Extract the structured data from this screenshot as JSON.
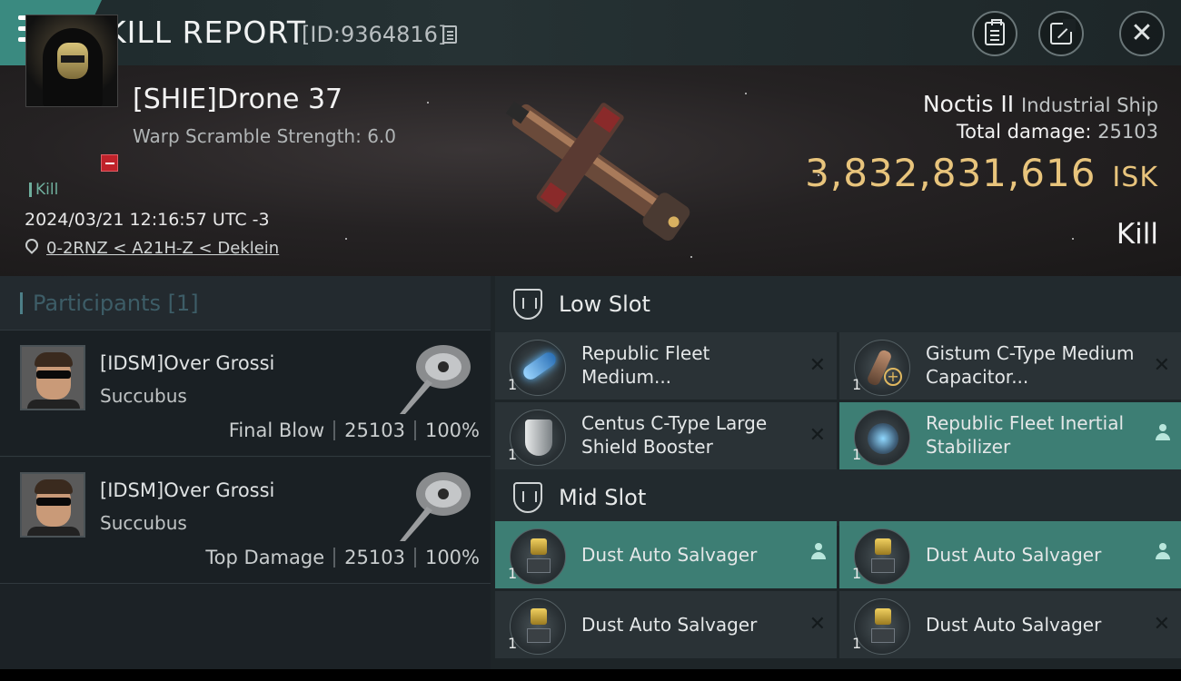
{
  "topbar": {
    "title": "KILL REPORT",
    "report_id": "[ID:9364816]"
  },
  "victim": {
    "name": "[SHIE]Drone 37",
    "warp_scramble": "Warp Scramble Strength: 6.0",
    "kill_tag": "Kill",
    "date": "2024/03/21 12:16:57 UTC -3",
    "location": "0-2RNZ < A21H-Z < Deklein"
  },
  "ship": {
    "name": "Noctis II",
    "class": "Industrial Ship",
    "total_damage_label": "Total damage:",
    "total_damage": "25103",
    "isk_value": "3,832,831,616",
    "isk_unit": "ISK",
    "result": "Kill"
  },
  "participants": {
    "title": "Participants",
    "count": "[1]",
    "items": [
      {
        "name": "[IDSM]Over Grossi",
        "ship": "Succubus",
        "role": "Final Blow",
        "damage": "25103",
        "percent": "100%"
      },
      {
        "name": "[IDSM]Over Grossi",
        "ship": "Succubus",
        "role": "Top Damage",
        "damage": "25103",
        "percent": "100%"
      }
    ]
  },
  "fittings": {
    "low_slot": {
      "title": "Low Slot",
      "modules": [
        {
          "name": "Republic Fleet Medium...",
          "qty": "1",
          "status": "destroyed"
        },
        {
          "name": "Gistum C-Type Medium Capacitor...",
          "qty": "1",
          "status": "destroyed"
        },
        {
          "name": "Centus C-Type Large Shield Booster",
          "qty": "1",
          "status": "destroyed"
        },
        {
          "name": "Republic Fleet Inertial Stabilizer",
          "qty": "1",
          "status": "dropped"
        }
      ]
    },
    "mid_slot": {
      "title": "Mid Slot",
      "modules": [
        {
          "name": "Dust Auto Salvager",
          "qty": "1",
          "status": "dropped"
        },
        {
          "name": "Dust Auto Salvager",
          "qty": "1",
          "status": "dropped"
        },
        {
          "name": "Dust Auto Salvager",
          "qty": "1",
          "status": "destroyed"
        },
        {
          "name": "Dust Auto Salvager",
          "qty": "1",
          "status": "destroyed"
        }
      ]
    }
  },
  "icons": {
    "menu": "menu-icon",
    "copy": "copy-icon",
    "clipboard": "clipboard-icon",
    "share": "share-icon",
    "close": "close-icon",
    "location": "location-pin-icon",
    "slot": "slot-shield-icon",
    "destroyed": "x-icon",
    "dropped": "person-icon"
  },
  "colors": {
    "accent_teal": "#3d7e74",
    "isk_gold": "#e8c47c",
    "loss_red": "#c0222a"
  }
}
